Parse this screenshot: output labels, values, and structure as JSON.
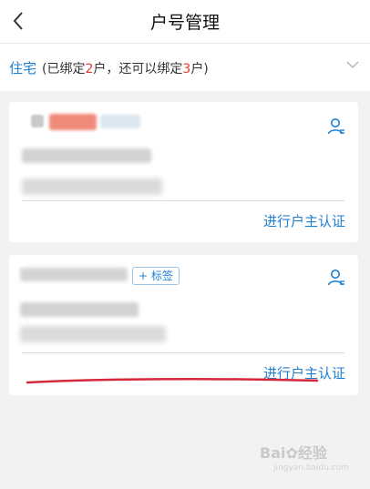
{
  "header": {
    "title": "户号管理",
    "back_icon": "chevron-left-icon"
  },
  "filter": {
    "type_label": "住宅",
    "desc_prefix": "(已绑定",
    "bound_count": "2",
    "desc_middle": "户，还可以绑定",
    "remaining_count": "3",
    "desc_suffix": "户)",
    "expand_icon": "chevron-down-icon"
  },
  "accounts": [
    {
      "owner_auth_label": "进行户主认证",
      "icon": "user-settings-icon"
    },
    {
      "owner_auth_label": "进行户主认证",
      "icon": "user-settings-icon",
      "tag_label": "+ 标签"
    }
  ],
  "watermark": {
    "brand": "Bai",
    "brand_suffix": "经验",
    "url": "jingyan.baidu.com"
  },
  "colors": {
    "accent": "#1f7fd0",
    "highlight_number": "#e23b2e",
    "annotation_line": "#d6283a"
  }
}
